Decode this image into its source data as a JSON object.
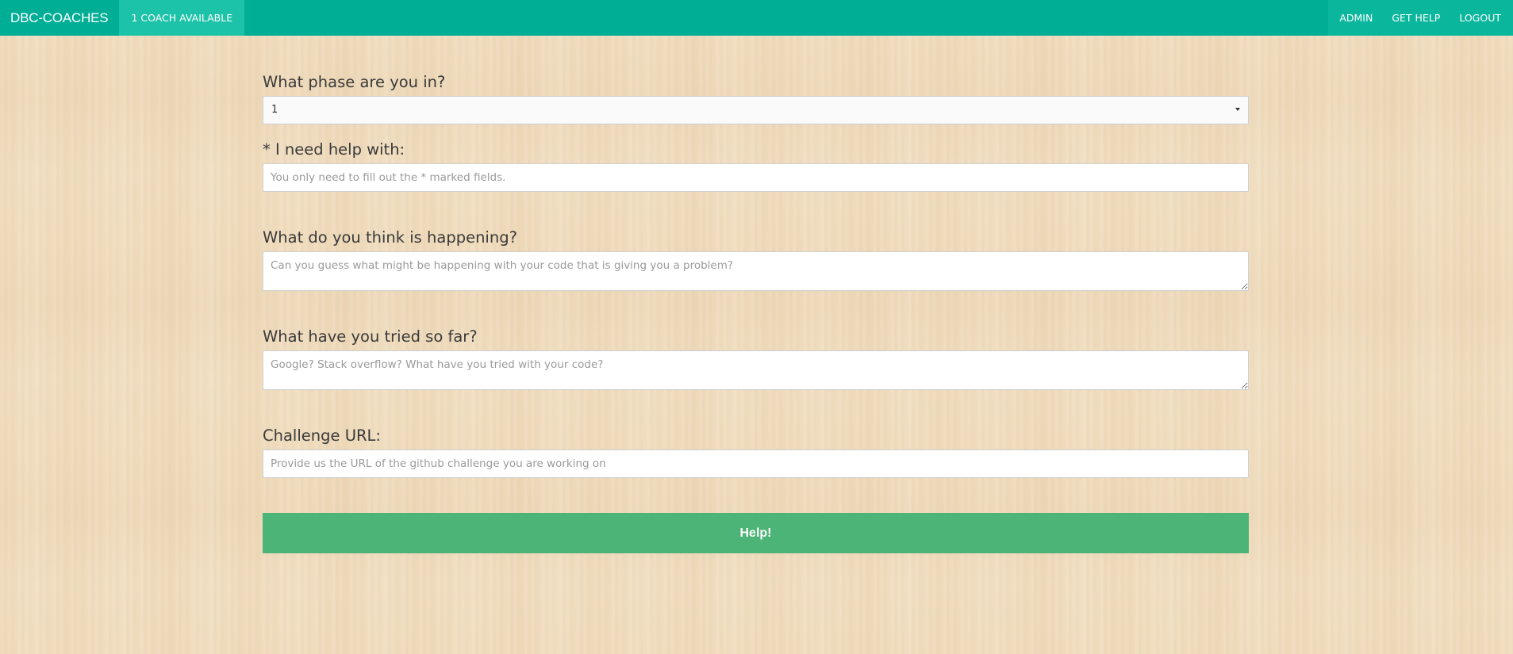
{
  "navbar": {
    "brand": "DBC-COACHES",
    "availability": "1 COACH AVAILABLE",
    "right_items": [
      "ADMIN",
      "GET HELP",
      "LOGOUT"
    ]
  },
  "form": {
    "phase": {
      "label": "What phase are you in?",
      "selected": "1"
    },
    "help_with": {
      "label": "* I need help with:",
      "placeholder": "You only need to fill out the * marked fields.",
      "value": ""
    },
    "happening": {
      "label": "What do you think is happening?",
      "placeholder": "Can you guess what might be happening with your code that is giving you a problem?",
      "value": ""
    },
    "tried": {
      "label": "What have you tried so far?",
      "placeholder": "Google? Stack overflow? What have you tried with your code?",
      "value": ""
    },
    "challenge_url": {
      "label": "Challenge URL:",
      "placeholder": "Provide us the URL of the github challenge you are working on",
      "value": ""
    },
    "submit_label": "Help!"
  },
  "colors": {
    "navbar": "#00ae95",
    "navbar_active": "#1dc3a8",
    "button": "#4db477",
    "background": "#f0dcbd"
  }
}
